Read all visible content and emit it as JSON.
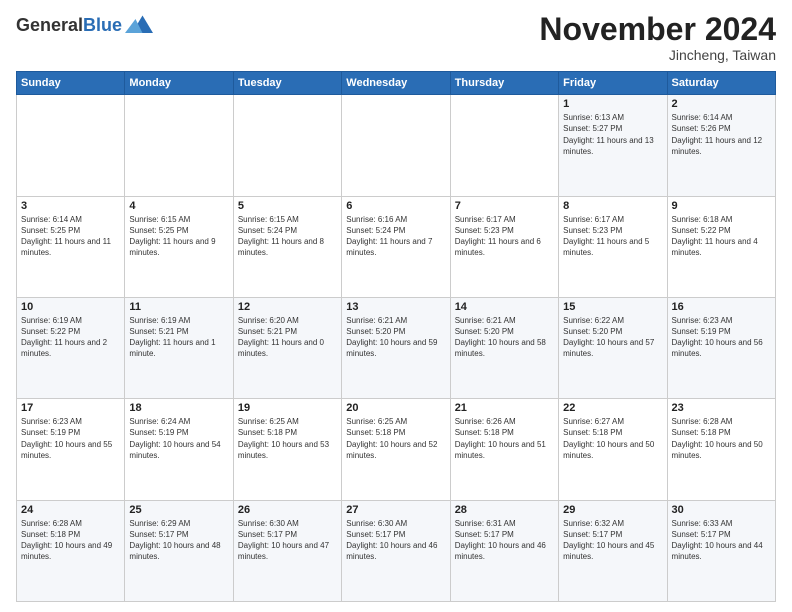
{
  "logo": {
    "general": "General",
    "blue": "Blue"
  },
  "title": {
    "month": "November 2024",
    "location": "Jincheng, Taiwan"
  },
  "headers": [
    "Sunday",
    "Monday",
    "Tuesday",
    "Wednesday",
    "Thursday",
    "Friday",
    "Saturday"
  ],
  "weeks": [
    [
      {
        "day": "",
        "info": ""
      },
      {
        "day": "",
        "info": ""
      },
      {
        "day": "",
        "info": ""
      },
      {
        "day": "",
        "info": ""
      },
      {
        "day": "",
        "info": ""
      },
      {
        "day": "1",
        "info": "Sunrise: 6:13 AM\nSunset: 5:27 PM\nDaylight: 11 hours and 13 minutes."
      },
      {
        "day": "2",
        "info": "Sunrise: 6:14 AM\nSunset: 5:26 PM\nDaylight: 11 hours and 12 minutes."
      }
    ],
    [
      {
        "day": "3",
        "info": "Sunrise: 6:14 AM\nSunset: 5:25 PM\nDaylight: 11 hours and 11 minutes."
      },
      {
        "day": "4",
        "info": "Sunrise: 6:15 AM\nSunset: 5:25 PM\nDaylight: 11 hours and 9 minutes."
      },
      {
        "day": "5",
        "info": "Sunrise: 6:15 AM\nSunset: 5:24 PM\nDaylight: 11 hours and 8 minutes."
      },
      {
        "day": "6",
        "info": "Sunrise: 6:16 AM\nSunset: 5:24 PM\nDaylight: 11 hours and 7 minutes."
      },
      {
        "day": "7",
        "info": "Sunrise: 6:17 AM\nSunset: 5:23 PM\nDaylight: 11 hours and 6 minutes."
      },
      {
        "day": "8",
        "info": "Sunrise: 6:17 AM\nSunset: 5:23 PM\nDaylight: 11 hours and 5 minutes."
      },
      {
        "day": "9",
        "info": "Sunrise: 6:18 AM\nSunset: 5:22 PM\nDaylight: 11 hours and 4 minutes."
      }
    ],
    [
      {
        "day": "10",
        "info": "Sunrise: 6:19 AM\nSunset: 5:22 PM\nDaylight: 11 hours and 2 minutes."
      },
      {
        "day": "11",
        "info": "Sunrise: 6:19 AM\nSunset: 5:21 PM\nDaylight: 11 hours and 1 minute."
      },
      {
        "day": "12",
        "info": "Sunrise: 6:20 AM\nSunset: 5:21 PM\nDaylight: 11 hours and 0 minutes."
      },
      {
        "day": "13",
        "info": "Sunrise: 6:21 AM\nSunset: 5:20 PM\nDaylight: 10 hours and 59 minutes."
      },
      {
        "day": "14",
        "info": "Sunrise: 6:21 AM\nSunset: 5:20 PM\nDaylight: 10 hours and 58 minutes."
      },
      {
        "day": "15",
        "info": "Sunrise: 6:22 AM\nSunset: 5:20 PM\nDaylight: 10 hours and 57 minutes."
      },
      {
        "day": "16",
        "info": "Sunrise: 6:23 AM\nSunset: 5:19 PM\nDaylight: 10 hours and 56 minutes."
      }
    ],
    [
      {
        "day": "17",
        "info": "Sunrise: 6:23 AM\nSunset: 5:19 PM\nDaylight: 10 hours and 55 minutes."
      },
      {
        "day": "18",
        "info": "Sunrise: 6:24 AM\nSunset: 5:19 PM\nDaylight: 10 hours and 54 minutes."
      },
      {
        "day": "19",
        "info": "Sunrise: 6:25 AM\nSunset: 5:18 PM\nDaylight: 10 hours and 53 minutes."
      },
      {
        "day": "20",
        "info": "Sunrise: 6:25 AM\nSunset: 5:18 PM\nDaylight: 10 hours and 52 minutes."
      },
      {
        "day": "21",
        "info": "Sunrise: 6:26 AM\nSunset: 5:18 PM\nDaylight: 10 hours and 51 minutes."
      },
      {
        "day": "22",
        "info": "Sunrise: 6:27 AM\nSunset: 5:18 PM\nDaylight: 10 hours and 50 minutes."
      },
      {
        "day": "23",
        "info": "Sunrise: 6:28 AM\nSunset: 5:18 PM\nDaylight: 10 hours and 50 minutes."
      }
    ],
    [
      {
        "day": "24",
        "info": "Sunrise: 6:28 AM\nSunset: 5:18 PM\nDaylight: 10 hours and 49 minutes."
      },
      {
        "day": "25",
        "info": "Sunrise: 6:29 AM\nSunset: 5:17 PM\nDaylight: 10 hours and 48 minutes."
      },
      {
        "day": "26",
        "info": "Sunrise: 6:30 AM\nSunset: 5:17 PM\nDaylight: 10 hours and 47 minutes."
      },
      {
        "day": "27",
        "info": "Sunrise: 6:30 AM\nSunset: 5:17 PM\nDaylight: 10 hours and 46 minutes."
      },
      {
        "day": "28",
        "info": "Sunrise: 6:31 AM\nSunset: 5:17 PM\nDaylight: 10 hours and 46 minutes."
      },
      {
        "day": "29",
        "info": "Sunrise: 6:32 AM\nSunset: 5:17 PM\nDaylight: 10 hours and 45 minutes."
      },
      {
        "day": "30",
        "info": "Sunrise: 6:33 AM\nSunset: 5:17 PM\nDaylight: 10 hours and 44 minutes."
      }
    ]
  ]
}
